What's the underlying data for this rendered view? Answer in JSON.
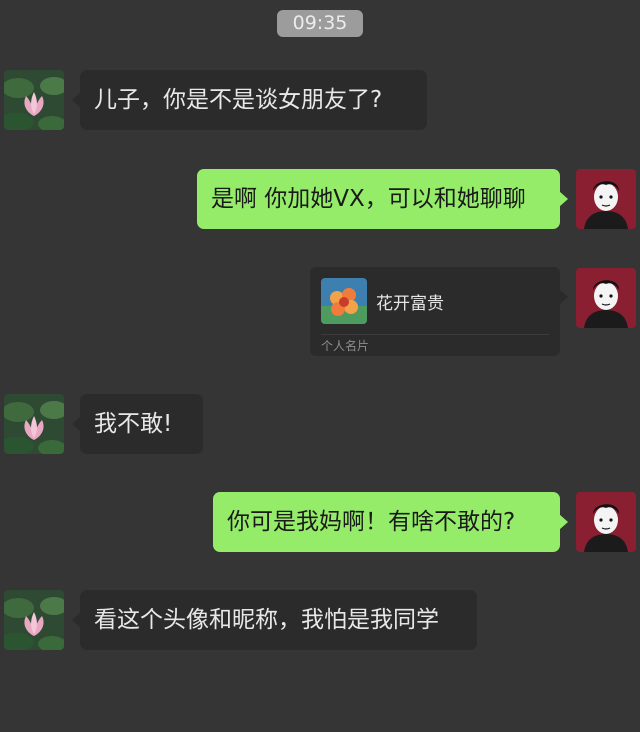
{
  "timestamp": "09:35",
  "contact_card": {
    "name": "花开富贵",
    "type_label": "个人名片"
  },
  "messages": [
    {
      "side": "left",
      "text": "儿子，你是不是谈女朋友了?"
    },
    {
      "side": "right",
      "text": "是啊 你加她VX，可以和她聊聊"
    },
    {
      "side": "right",
      "type": "contact_card"
    },
    {
      "side": "left",
      "text": "我不敢!"
    },
    {
      "side": "right",
      "text": "你可是我妈啊！有啥不敢的?"
    },
    {
      "side": "left",
      "text": "看这个头像和昵称，我怕是我同学"
    }
  ],
  "colors": {
    "background": "#353535",
    "incoming_bubble": "#2b2b2b",
    "outgoing_bubble": "#95ec69",
    "timestamp_bg": "#9c9c9c"
  },
  "icons": {
    "mother_avatar": "lotus-avatar-icon",
    "son_avatar": "boy-sketch-avatar-icon",
    "card_avatar": "flower-avatar-icon"
  }
}
